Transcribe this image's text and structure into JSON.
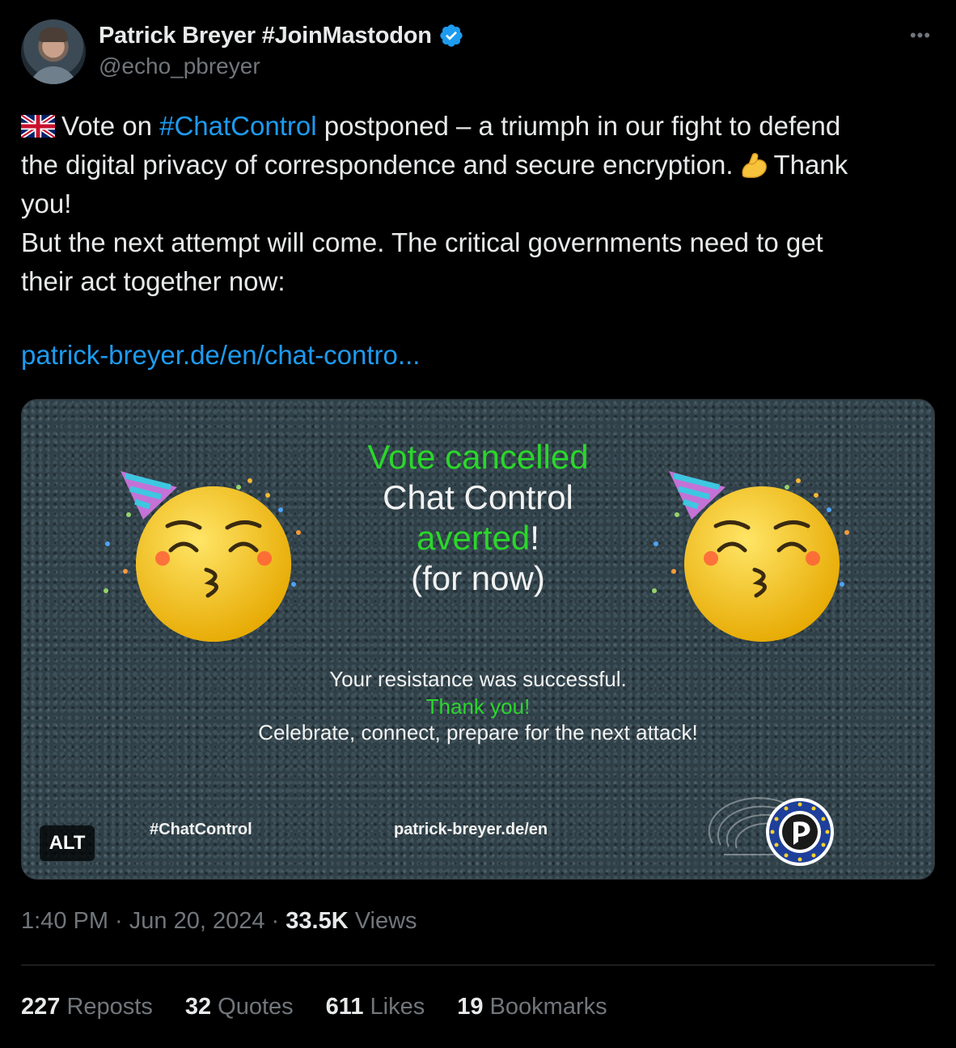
{
  "author": {
    "display_name": "Patrick Breyer #JoinMastodon",
    "handle": "@echo_pbreyer",
    "verified_color": "#1d9bf0"
  },
  "tweet": {
    "line1_pre": "Vote on ",
    "line1_hashtag": "#ChatControl",
    "line1_post": " postponed – a triumph in our fight to defend",
    "line2_pre": "the digital privacy of correspondence and secure encryption.",
    "line2_post": "Thank",
    "line3": "you!",
    "line4": "But the next attempt will come. The critical governments need to get",
    "line5": "their act together now:",
    "link": "patrick-breyer.de/en/chat-contro..."
  },
  "media": {
    "title_green": "Vote cancelled",
    "title_line2": "Chat Control",
    "title_line3_green": "averted",
    "title_line3_white": "!",
    "title_line4": "(for now)",
    "sub1": "Your resistance was successful.",
    "sub2": "Thank you!",
    "sub3": "Celebrate, connect, prepare for the next attack!",
    "footer_hashtag": "#ChatControl",
    "footer_site": "patrick-breyer.de/en",
    "alt_label": "ALT"
  },
  "meta": {
    "time": "1:40 PM",
    "separator": " · ",
    "date": "Jun 20, 2024",
    "views_count": "33.5K",
    "views_label": " Views"
  },
  "stats": {
    "reposts_count": "227",
    "reposts_label": " Reposts",
    "quotes_count": "32",
    "quotes_label": " Quotes",
    "likes_count": "611",
    "likes_label": " Likes",
    "bookmarks_count": "19",
    "bookmarks_label": " Bookmarks"
  },
  "colors": {
    "background": "#000000",
    "text": "#e7e9ea",
    "muted": "#71767b",
    "link": "#1d9bf0",
    "media_green": "#2bd62b"
  }
}
